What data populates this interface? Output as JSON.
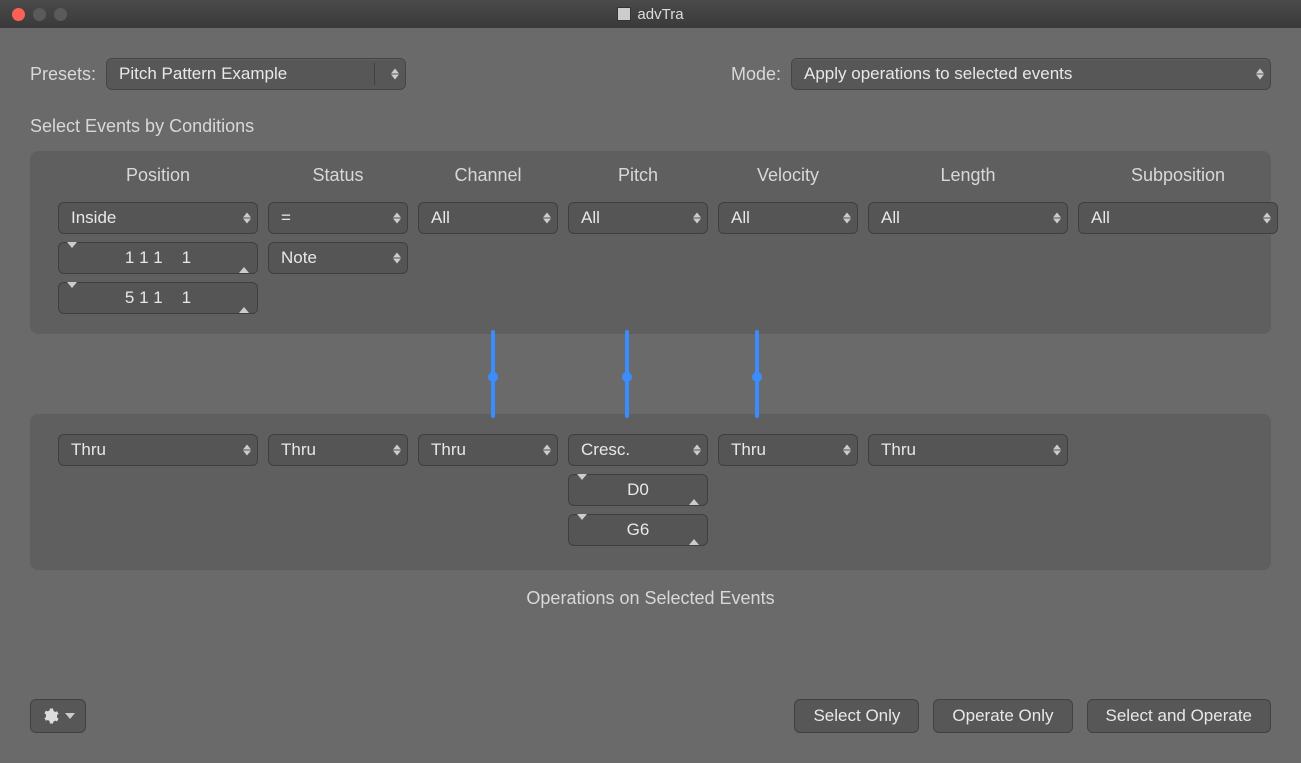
{
  "title": "advTra",
  "header": {
    "presets_label": "Presets:",
    "preset_value": "Pitch Pattern Example",
    "mode_label": "Mode:",
    "mode_value": "Apply operations to selected events"
  },
  "conditions": {
    "section_title": "Select Events by Conditions",
    "columns": [
      "Position",
      "Status",
      "Channel",
      "Pitch",
      "Velocity",
      "Length",
      "Subposition"
    ],
    "position": {
      "op": "Inside",
      "val1": "1 1 1    1",
      "val2": "5 1 1    1"
    },
    "status": {
      "op": "=",
      "type": "Note"
    },
    "channel": {
      "op": "All"
    },
    "pitch": {
      "op": "All"
    },
    "velocity": {
      "op": "All"
    },
    "length": {
      "op": "All"
    },
    "subposition": {
      "op": "All"
    }
  },
  "operations": {
    "caption": "Operations on Selected Events",
    "position": {
      "op": "Thru"
    },
    "status": {
      "op": "Thru"
    },
    "channel": {
      "op": "Thru"
    },
    "pitch": {
      "op": "Cresc.",
      "val1": "D0",
      "val2": "G6"
    },
    "velocity": {
      "op": "Thru"
    },
    "length": {
      "op": "Thru"
    }
  },
  "footer": {
    "select_only": "Select Only",
    "operate_only": "Operate Only",
    "select_and_operate": "Select and Operate"
  }
}
